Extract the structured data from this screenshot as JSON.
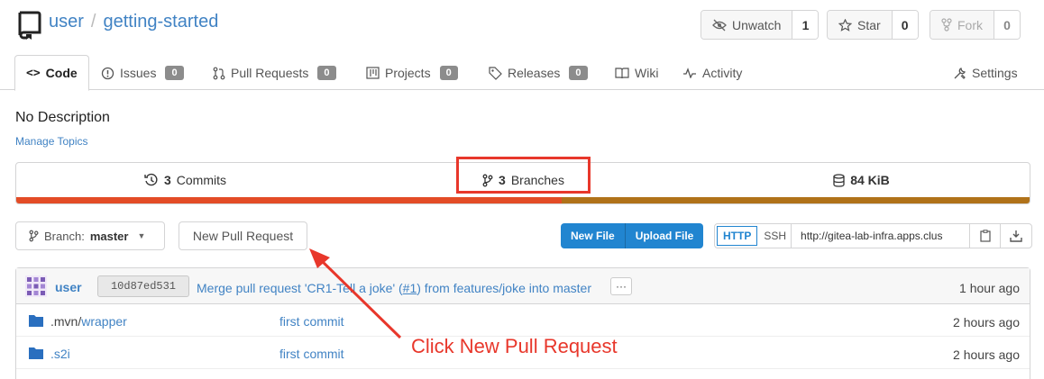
{
  "repo": {
    "owner": "user",
    "name": "getting-started",
    "separator": "/"
  },
  "actions": {
    "watch": {
      "label": "Unwatch",
      "count": "1"
    },
    "star": {
      "label": "Star",
      "count": "0"
    },
    "fork": {
      "label": "Fork",
      "count": "0"
    }
  },
  "tabs": [
    {
      "label": "Code",
      "badge": ""
    },
    {
      "label": "Issues",
      "badge": "0"
    },
    {
      "label": "Pull Requests",
      "badge": "0"
    },
    {
      "label": "Projects",
      "badge": "0"
    },
    {
      "label": "Releases",
      "badge": "0"
    },
    {
      "label": "Wiki",
      "badge": ""
    },
    {
      "label": "Activity",
      "badge": ""
    },
    {
      "label": "Settings",
      "badge": ""
    }
  ],
  "description": "No Description",
  "manage_topics": "Manage Topics",
  "stats": {
    "commits_count": "3",
    "commits_label": "Commits",
    "branches_count": "3",
    "branches_label": "Branches",
    "size": "84 KiB"
  },
  "language_colors": [
    "#e34c26",
    "#b07219"
  ],
  "branch": {
    "prefix": "Branch:",
    "name": "master"
  },
  "new_pr": "New Pull Request",
  "file_buttons": {
    "new_file": "New File",
    "upload_file": "Upload File"
  },
  "clone": {
    "http": "HTTP",
    "ssh": "SSH",
    "url": "http://gitea-lab-infra.apps.clus"
  },
  "latest_commit": {
    "user": "user",
    "sha": "10d87ed531",
    "message_prefix": "Merge pull request 'CR1-Tell a joke' (",
    "pr_ref": "#1",
    "message_suffix": ") from features/joke into master",
    "ellipsis": "···",
    "time": "1 hour ago"
  },
  "files": [
    {
      "prefix": ".mvn/",
      "name": "wrapper",
      "commit": "first commit",
      "time": "2 hours ago"
    },
    {
      "prefix": "",
      "name": ".s2i",
      "commit": "first commit",
      "time": "2 hours ago"
    }
  ],
  "annotation": "Click New Pull Request",
  "colors": {
    "link": "#4183c4",
    "primary": "#2185d0",
    "annotation": "#e8372b"
  }
}
